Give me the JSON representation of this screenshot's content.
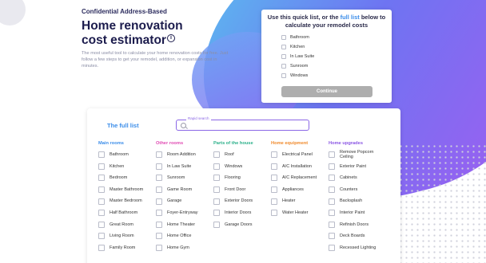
{
  "hero": {
    "eyebrow": "Confidential Address-Based",
    "title_line1": "Home renovation",
    "title_line2": "cost estimator",
    "info_icon": "i",
    "description": "The most useful tool to calculate your home renovation costs for free. Just follow a few steps to get your remodel, addition, or expansion cost in minutes."
  },
  "quick_list": {
    "heading_pre": "Use this quick list, or the ",
    "heading_link": "full list",
    "heading_post": " below to calculate your remodel costs",
    "items": [
      "Bathroom",
      "Kitchen",
      "In Law Suite",
      "Sunroom",
      "Windows"
    ],
    "continue_label": "Continue"
  },
  "full_list": {
    "title": "The full list",
    "search_label": "Rapid search",
    "columns": [
      {
        "heading": "Main rooms",
        "color": "#3b8de9",
        "items": [
          "Bathroom",
          "Kitchen",
          "Bedroom",
          "Master Bathroom",
          "Master Bedroom",
          "Half Bathroom",
          "Great Room",
          "Living Room",
          "Family Room"
        ]
      },
      {
        "heading": "Other rooms",
        "color": "#e04bb3",
        "items": [
          "Room Addition",
          "In Law Suite",
          "Sunroom",
          "Game Room",
          "Garage",
          "Foyer-Entryway",
          "Home Theater",
          "Home Office",
          "Home Gym"
        ]
      },
      {
        "heading": "Parts of the house",
        "color": "#2bb08a",
        "items": [
          "Roof",
          "Windows",
          "Flooring",
          "Front Door",
          "Exterior Doors",
          "Interior Doors",
          "Garage Doors"
        ]
      },
      {
        "heading": "Home equipment",
        "color": "#f08a2c",
        "items": [
          "Electrical Panel",
          "A/C Installation",
          "A/C Replacement",
          "Appliances",
          "Heater",
          "Water Heater"
        ]
      },
      {
        "heading": "Home upgrades",
        "color": "#8b57e4",
        "items": [
          "Remove Popcorn Ceiling",
          "Exterior Paint",
          "Cabinets",
          "Counters",
          "Backsplash",
          "Interior Paint",
          "Refinish Doors",
          "Deck Boards",
          "Recessed Lighting"
        ]
      }
    ]
  }
}
